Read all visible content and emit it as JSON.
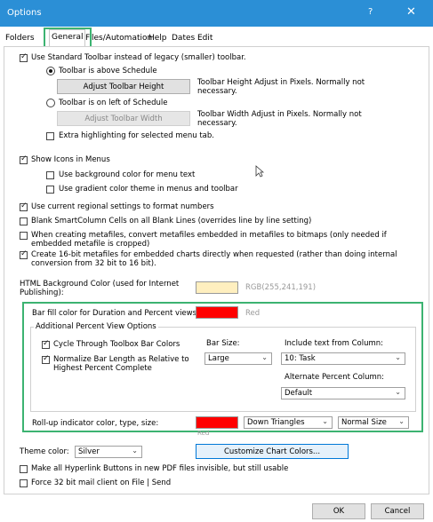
{
  "window": {
    "title": "Options",
    "help": "?",
    "close": "✕"
  },
  "tabs": [
    {
      "label": "Folders"
    },
    {
      "label": "General"
    },
    {
      "label": "Files/Automation"
    },
    {
      "label": "Help"
    },
    {
      "label": "Dates"
    },
    {
      "label": "Edit"
    }
  ],
  "toolbar": {
    "use_standard": "Use Standard Toolbar instead of legacy (smaller) toolbar.",
    "above_schedule": "Toolbar is above Schedule",
    "adjust_height_btn": "Adjust Toolbar Height",
    "adjust_height_note": "Toolbar Height Adjust in Pixels. Normally not necessary.",
    "left_schedule": "Toolbar is on left of Schedule",
    "adjust_width_btn": "Adjust Toolbar Width",
    "adjust_width_note": "Toolbar Width Adjust in Pixels. Normally not necessary.",
    "extra_highlight": "Extra highlighting for selected menu tab."
  },
  "menus": {
    "show_icons": "Show Icons in Menus",
    "bg_color": "Use background color for menu text",
    "gradient": "Use gradient color theme in menus and toolbar"
  },
  "regional": "Use current regional settings to format numbers",
  "blank_smartcolumn": "Blank SmartColumn Cells on all Blank Lines (overrides line by line setting)",
  "metafiles_convert": "When creating metafiles, convert metafiles embedded in metafiles to bitmaps (only needed if embedded metafile is cropped)",
  "metafiles_16bit": "Create 16-bit metafiles for embedded charts directly when requested (rather than doing internal conversion from 32 bit to 16 bit).",
  "html_bg": {
    "label": "HTML Background Color (used for Internet Publishing):",
    "swatch_color": "#ffefbf",
    "value": "RGB(255,241,191)"
  },
  "bar_fill": {
    "label": "Bar fill color for Duration and Percent views:",
    "swatch_color": "#ff0000",
    "value": "Red"
  },
  "percent_options": {
    "group_title": "Additional Percent View Options",
    "cycle": "Cycle Through Toolbox Bar Colors",
    "normalize": "Normalize Bar Length as Relative to Highest Percent Complete",
    "bar_size_label": "Bar Size:",
    "bar_size_value": "Large",
    "include_text_label": "Include text from Column:",
    "include_text_value": "10: Task",
    "alt_percent_label": "Alternate Percent Column:",
    "alt_percent_value": "Default"
  },
  "rollup": {
    "label": "Roll-up indicator color, type, size:",
    "swatch_color": "#ff0000",
    "color_text": "Red",
    "type_value": "Down Triangles",
    "size_value": "Normal Size"
  },
  "theme": {
    "label": "Theme color:",
    "value": "Silver",
    "customize_btn": "Customize Chart Colors..."
  },
  "pdf_links": "Make all Hyperlink Buttons in new PDF files invisible, but still usable",
  "mail_client": "Force 32 bit mail client on File | Send",
  "footer": {
    "ok": "OK",
    "cancel": "Cancel"
  },
  "colors": {
    "titlebar": "#2b8fd6",
    "highlight": "#3cb371"
  }
}
